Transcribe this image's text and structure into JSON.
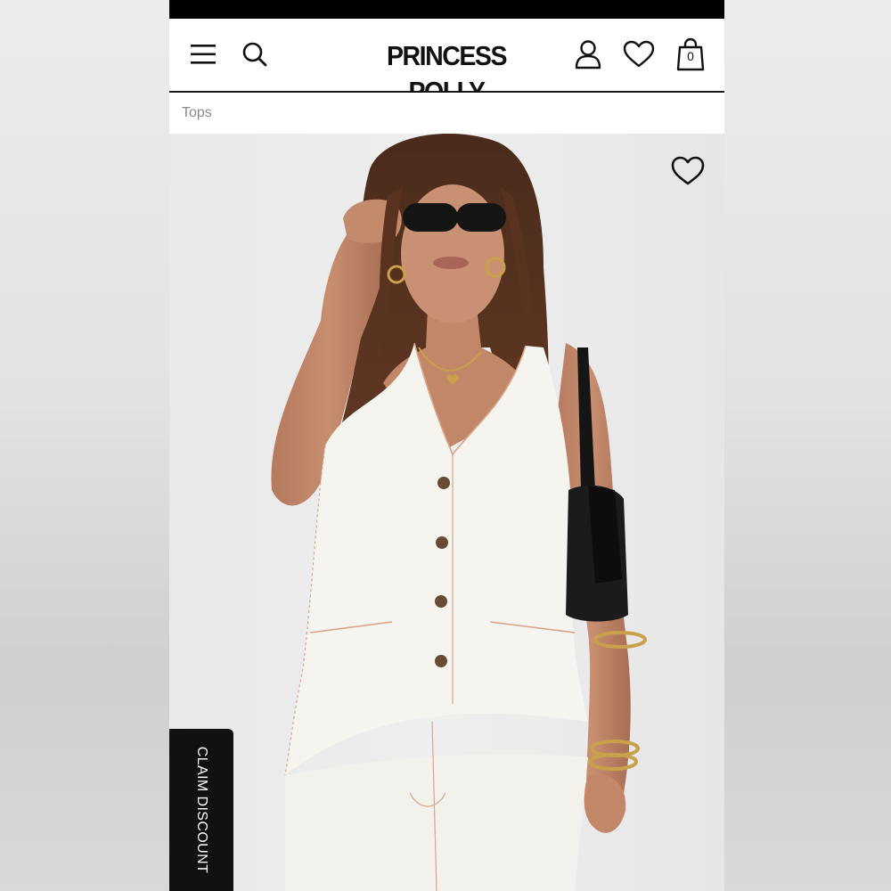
{
  "brand": {
    "logo_text": "PRINCESS POLLY"
  },
  "header": {
    "icons": [
      "menu-icon",
      "search-icon",
      "account-icon",
      "wishlist-icon",
      "cart-icon"
    ],
    "cart_count": "0"
  },
  "breadcrumb": {
    "label": "Tops"
  },
  "product": {
    "image_description_icon": "product-photo",
    "wishlist_icon": "heart-outline-icon"
  },
  "promo": {
    "claim_label": "CLAIM DISCOUNT"
  },
  "colors": {
    "banner": "#000000",
    "header_bg": "#ffffff",
    "breadcrumb_text": "#8a8a8a",
    "photo_bg": "#ececec",
    "claim_bg": "#111111"
  }
}
